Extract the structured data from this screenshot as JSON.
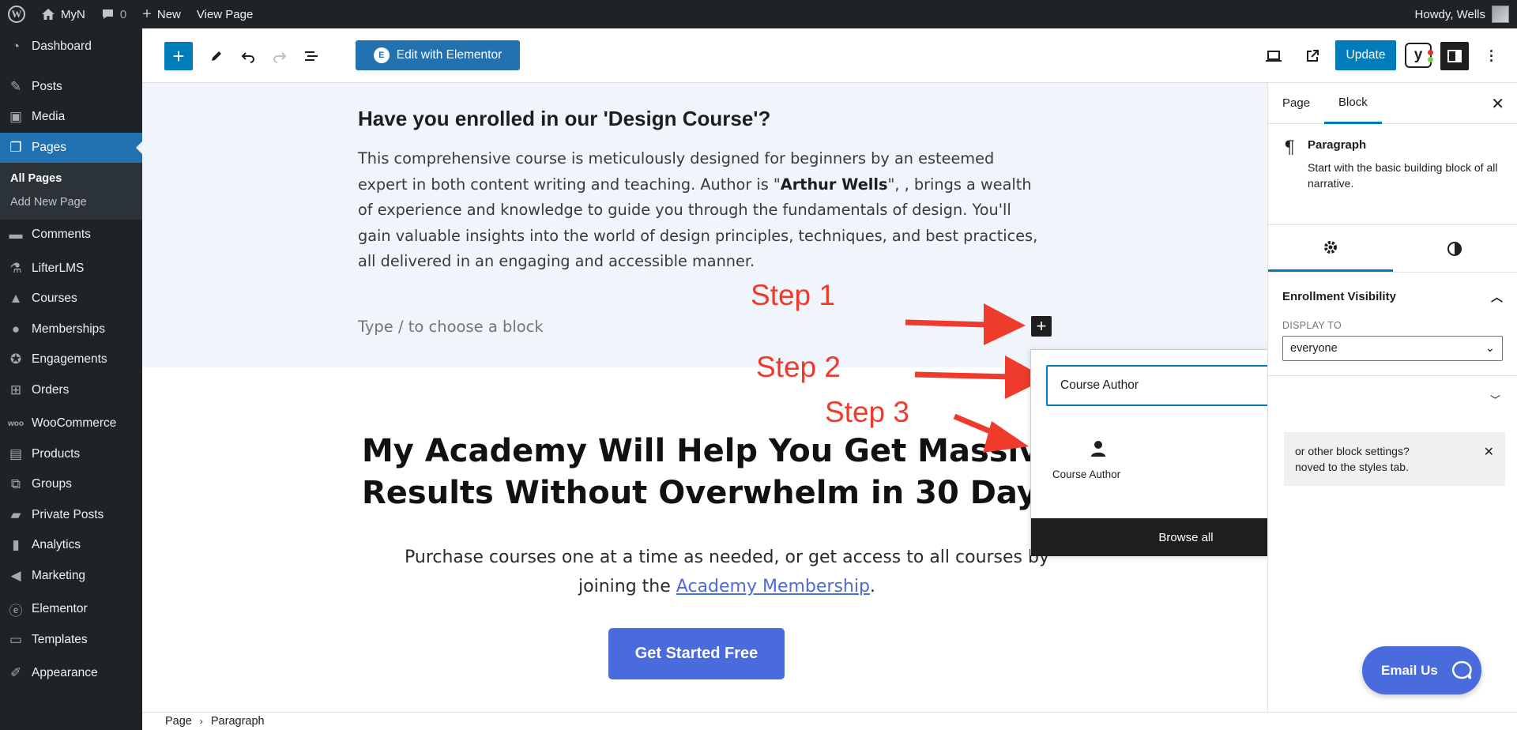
{
  "adminbar": {
    "site_name": "MyN",
    "comments_count": "0",
    "new_label": "New",
    "view_page_label": "View Page",
    "howdy": "Howdy, Wells"
  },
  "sidebar": {
    "items": [
      {
        "label": "Dashboard",
        "icon": "dashboard-icon"
      },
      {
        "label": "Posts",
        "icon": "pin-icon"
      },
      {
        "label": "Media",
        "icon": "media-icon"
      },
      {
        "label": "Pages",
        "icon": "pages-icon"
      },
      {
        "label": "Comments",
        "icon": "comment-icon"
      },
      {
        "label": "LifterLMS",
        "icon": "lifterlms-icon"
      },
      {
        "label": "Courses",
        "icon": "graduation-cap-icon"
      },
      {
        "label": "Memberships",
        "icon": "groups-icon"
      },
      {
        "label": "Engagements",
        "icon": "award-icon"
      },
      {
        "label": "Orders",
        "icon": "cart-icon"
      },
      {
        "label": "WooCommerce",
        "icon": "woo-icon"
      },
      {
        "label": "Products",
        "icon": "archive-icon"
      },
      {
        "label": "Groups",
        "icon": "network-icon"
      },
      {
        "label": "Private Posts",
        "icon": "lock-icon"
      },
      {
        "label": "Analytics",
        "icon": "bar-chart-icon"
      },
      {
        "label": "Marketing",
        "icon": "megaphone-icon"
      },
      {
        "label": "Elementor",
        "icon": "elementor-icon"
      },
      {
        "label": "Templates",
        "icon": "folder-icon"
      },
      {
        "label": "Appearance",
        "icon": "brush-icon"
      }
    ],
    "submenu": [
      "All Pages",
      "Add New Page"
    ]
  },
  "toolbar": {
    "elementor_label": "Edit with Elementor",
    "update_label": "Update",
    "yoast_label": "y"
  },
  "canvas": {
    "heading": "Have you enrolled in our 'Design Course'?",
    "para_before": "This comprehensive course is meticulously designed for beginners by an esteemed expert in both content writing and teaching. Author is \"",
    "para_bold": "Arthur Wells",
    "para_after": "\", , brings a wealth of experience and knowledge to guide you through the fundamentals of design. You'll gain valuable insights into the world of design principles, techniques, and best practices, all delivered in an engaging and accessible manner.",
    "placeholder": "Type / to choose a block",
    "hero_line1": "My Academy Will Help You Get Massiv",
    "hero_line2": "Results Without Overwhelm in 30 Day",
    "hero_sub_before": "Purchase courses one at a time as needed, or get access to all courses by joining the ",
    "hero_sub_link": "Academy Membership",
    "hero_sub_after": ".",
    "cta_label": "Get Started Free"
  },
  "annotations": {
    "step1": "Step 1",
    "step2": "Step 2",
    "step3": "Step 3",
    "arrow_color": "#ee3b2c"
  },
  "inserter": {
    "search_value": "Course Author",
    "result_label": "Course Author",
    "browse_all": "Browse all"
  },
  "settings": {
    "tab_page": "Page",
    "tab_block": "Block",
    "block_title": "Paragraph",
    "block_desc": "Start with the basic building block of all narrative.",
    "panel_title": "Enrollment Visibility",
    "display_to_label": "DISPLAY TO",
    "display_to_value": "everyone",
    "notice_line1": "or other block settings?",
    "notice_line2": "noved to the styles tab."
  },
  "email_us": "Email Us",
  "breadcrumb": {
    "page": "Page",
    "block": "Paragraph"
  },
  "colors": {
    "admin_dark": "#1d2327",
    "wp_blue": "#007cba",
    "menu_active": "#2271b1",
    "brand_blue": "#4a6bdc"
  }
}
